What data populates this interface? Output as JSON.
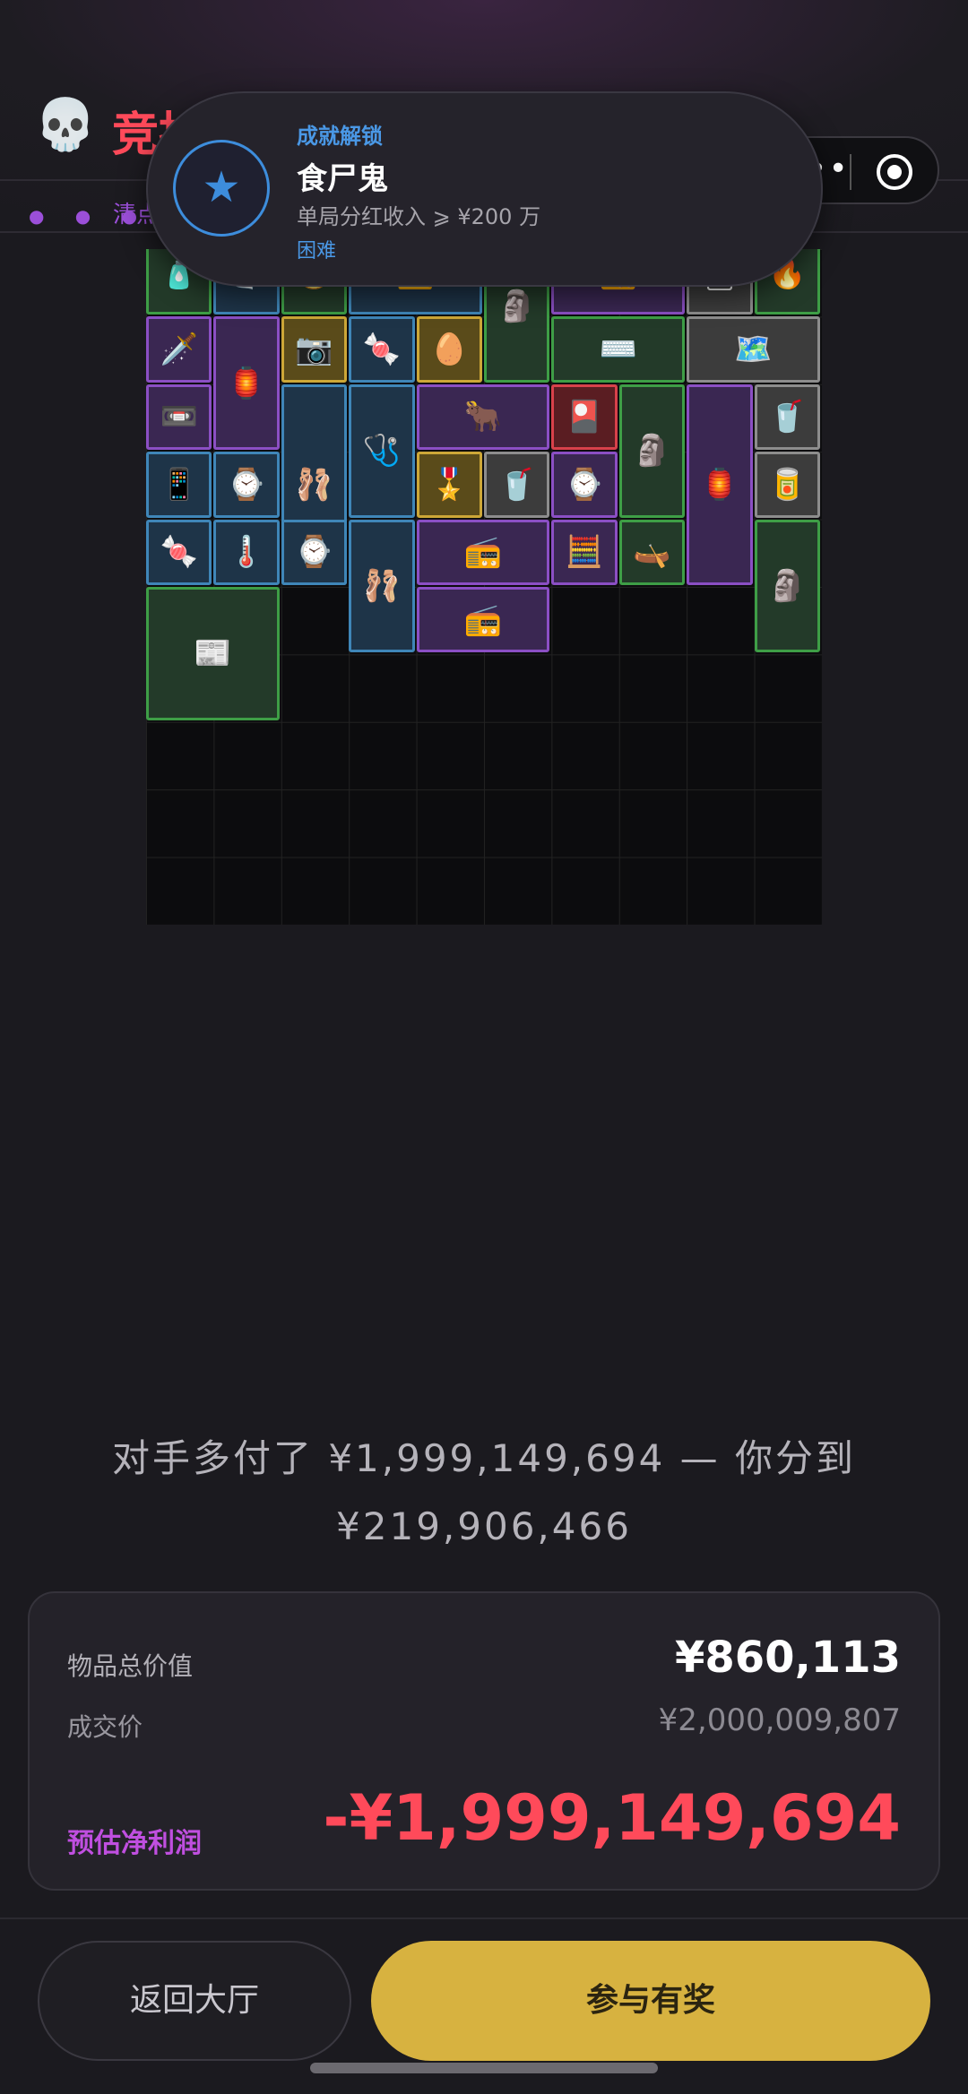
{
  "header": {
    "title": "竞拍",
    "skull_icon": "💀",
    "sub_label": "清点"
  },
  "toast": {
    "heading": "成就解锁",
    "name": "食尸鬼",
    "description": "单局分红收入 ⩾ ¥200 万",
    "difficulty": "困难",
    "icon": "star-icon"
  },
  "capsule": {
    "more_icon": "more-dots-icon",
    "target_icon": "target-icon"
  },
  "grid": {
    "items": [
      {
        "icon": "🧴",
        "rarity": "g"
      },
      {
        "icon": "🧻",
        "rarity": "b"
      },
      {
        "icon": "🪙",
        "rarity": "g"
      },
      {
        "icon": "🟨",
        "rarity": "b"
      },
      {
        "icon": "🗿",
        "rarity": "g"
      },
      {
        "icon": "📻",
        "rarity": "p"
      },
      {
        "icon": "🃏",
        "rarity": "gr"
      },
      {
        "icon": "🔥",
        "rarity": "g"
      },
      {
        "icon": "🗡️",
        "rarity": "p"
      },
      {
        "icon": "🏮",
        "rarity": "p"
      },
      {
        "icon": "📷",
        "rarity": "y"
      },
      {
        "icon": "🍬",
        "rarity": "b"
      },
      {
        "icon": "🥚",
        "rarity": "y"
      },
      {
        "icon": "⌨️",
        "rarity": "g"
      },
      {
        "icon": "🗺️",
        "rarity": "gr"
      },
      {
        "icon": "📼",
        "rarity": "p"
      },
      {
        "icon": "🩰",
        "rarity": "b"
      },
      {
        "icon": "🩺",
        "rarity": "b"
      },
      {
        "icon": "🐂",
        "rarity": "p"
      },
      {
        "icon": "🎴",
        "rarity": "r"
      },
      {
        "icon": "🗿",
        "rarity": "g"
      },
      {
        "icon": "🏮",
        "rarity": "p"
      },
      {
        "icon": "🥤",
        "rarity": "gr"
      },
      {
        "icon": "📱",
        "rarity": "b"
      },
      {
        "icon": "⌚",
        "rarity": "b"
      },
      {
        "icon": "🎖️",
        "rarity": "y"
      },
      {
        "icon": "🥤",
        "rarity": "gr"
      },
      {
        "icon": "⌚",
        "rarity": "p"
      },
      {
        "icon": "🥫",
        "rarity": "gr"
      },
      {
        "icon": "🍬",
        "rarity": "b"
      },
      {
        "icon": "🌡️",
        "rarity": "b"
      },
      {
        "icon": "⌚",
        "rarity": "b"
      },
      {
        "icon": "🩰",
        "rarity": "b"
      },
      {
        "icon": "📻",
        "rarity": "p"
      },
      {
        "icon": "🧮",
        "rarity": "p"
      },
      {
        "icon": "🛶",
        "rarity": "g"
      },
      {
        "icon": "🗿",
        "rarity": "g"
      },
      {
        "icon": "📰",
        "rarity": "g"
      },
      {
        "icon": "📻",
        "rarity": "p"
      }
    ]
  },
  "message": {
    "line1": "对手多付了 ¥1,999,149,694 — 你分到",
    "line2": "¥219,906,466"
  },
  "summary": {
    "total_label": "物品总价值",
    "total_value": "¥860,113",
    "deal_label": "成交价",
    "deal_value": "¥2,000,009,807",
    "profit_label": "预估净利润",
    "profit_value": "-¥1,999,149,694"
  },
  "buttons": {
    "lobby": "返回大厅",
    "join": "参与有奖"
  },
  "colors": {
    "accent_red": "#ff4a5a",
    "accent_purple": "#c04fe0",
    "accent_gold": "#d7b240",
    "achievement_blue": "#3d8ddc"
  }
}
